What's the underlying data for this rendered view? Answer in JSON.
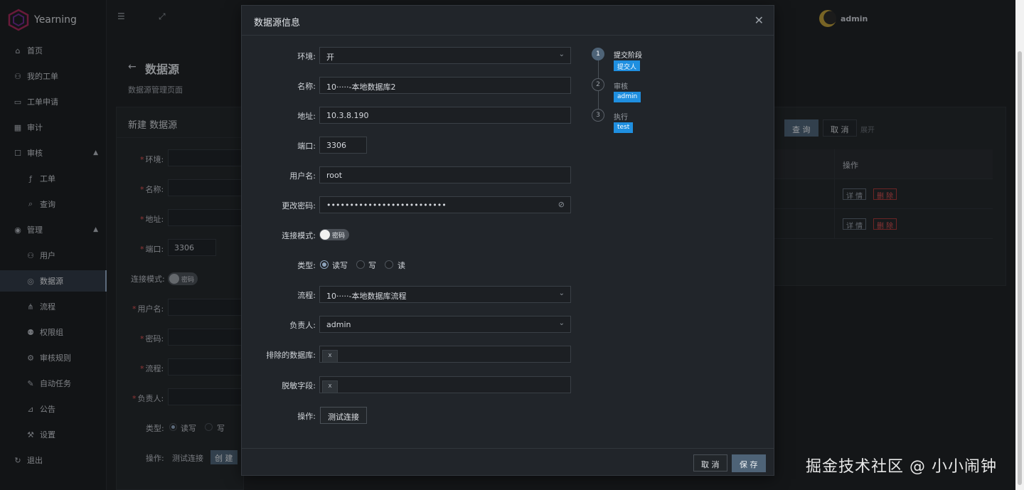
{
  "app": {
    "name": "Yearning",
    "user": "admin"
  },
  "sidebar": {
    "items": [
      {
        "label": "首页",
        "icon": "home-icon"
      },
      {
        "label": "我的工单",
        "icon": "user-icon"
      },
      {
        "label": "工单申请",
        "icon": "monitor-icon"
      },
      {
        "label": "审计",
        "icon": "chart-icon"
      },
      {
        "label": "审核",
        "icon": "audit-icon"
      },
      {
        "label": "工单",
        "icon": "fx-icon"
      },
      {
        "label": "查询",
        "icon": "search-icon"
      },
      {
        "label": "管理",
        "icon": "eye-icon"
      },
      {
        "label": "用户",
        "icon": "user-icon"
      },
      {
        "label": "数据源",
        "icon": "datasource-icon"
      },
      {
        "label": "流程",
        "icon": "flow-icon"
      },
      {
        "label": "权限组",
        "icon": "group-icon"
      },
      {
        "label": "审核规则",
        "icon": "rules-icon"
      },
      {
        "label": "自动任务",
        "icon": "task-icon"
      },
      {
        "label": "公告",
        "icon": "notice-icon"
      },
      {
        "label": "设置",
        "icon": "wrench-icon"
      },
      {
        "label": "退出",
        "icon": "logout-icon"
      }
    ]
  },
  "page": {
    "title": "数据源",
    "subtitle": "数据源管理页面",
    "new_card_title": "新建 数据源",
    "form": {
      "env": "环境:",
      "name": "名称:",
      "addr": "地址:",
      "port": "端口:",
      "port_value": "3306",
      "conn_mode": "连接模式:",
      "toggle_text": "密码",
      "user": "用户名:",
      "password": "密码:",
      "flow": "流程:",
      "owner": "负责人:",
      "type": "类型:",
      "type_rw": "读写",
      "type_w": "写",
      "op": "操作:",
      "test_conn": "测试连接",
      "create": "创 建"
    },
    "query_btn": "查 询",
    "cancel_btn": "取 消",
    "expand_link": "展开",
    "table_header_op": "操作",
    "row_detail": "详 情",
    "row_delete": "删 除"
  },
  "modal": {
    "title": "数据源信息",
    "env_label": "环境:",
    "env_value": "开",
    "name_label": "名称:",
    "name_value": "10·····-本地数据库2",
    "addr_label": "地址:",
    "addr_value": "10.3.8.190",
    "port_label": "端口:",
    "port_value": "3306",
    "user_label": "用户名:",
    "user_value": "root",
    "pwd_label": "更改密码:",
    "pwd_value": "••••••••••••••••••••••••••",
    "conn_label": "连接模式:",
    "conn_toggle": "密码",
    "type_label": "类型:",
    "type_rw": "读写",
    "type_w": "写",
    "type_r": "读",
    "flow_label": "流程:",
    "flow_value": "10·····-本地数据库流程",
    "owner_label": "负责人:",
    "owner_value": "admin",
    "exclude_db_label": "排除的数据库:",
    "mask_label": "脱敏字段:",
    "tag_x": "x",
    "op_label": "操作:",
    "test_btn": "测试连接",
    "cancel": "取 消",
    "save": "保 存"
  },
  "steps": [
    {
      "num": "1",
      "title": "提交阶段",
      "tag": "提交人"
    },
    {
      "num": "2",
      "title": "审核",
      "tag": "admin"
    },
    {
      "num": "3",
      "title": "执行",
      "tag": "test"
    }
  ],
  "watermark": "掘金技术社区 @ 小小闹钟",
  "colors": {
    "accent": "#4e6377",
    "tag_blue": "#1f8fe0",
    "danger": "#d65050"
  }
}
